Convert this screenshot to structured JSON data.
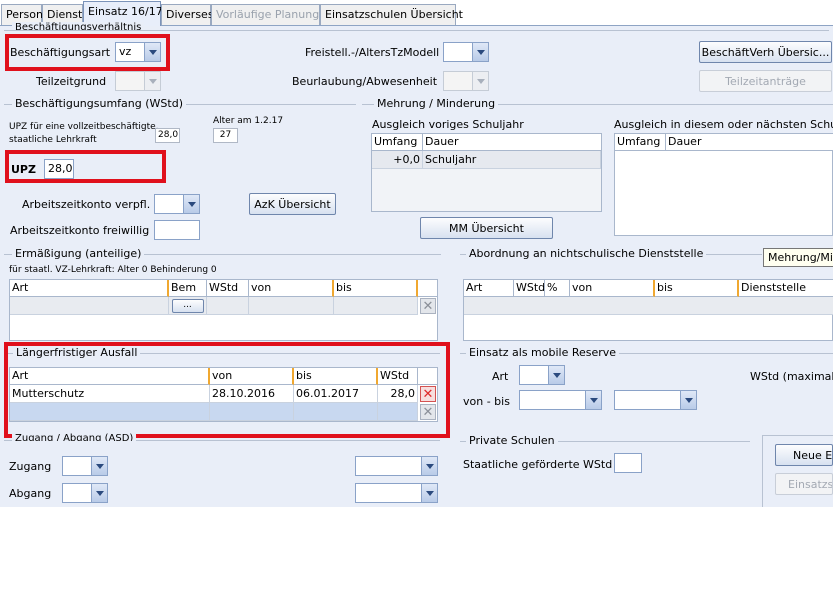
{
  "tabs": [
    {
      "label": "Person"
    },
    {
      "label": "Dienst"
    },
    {
      "label": "Einsatz 16/17"
    },
    {
      "label": "Diverses"
    },
    {
      "label": "Vorläufige Planung"
    },
    {
      "label": "Einsatzschulen Übersicht"
    }
  ],
  "beschaeftigungsverhaeltnis": {
    "title": "Beschäftigungsverhältnis",
    "art_label": "Beschäftigungsart",
    "art_value": "vz",
    "teilzeitgrund_label": "Teilzeitgrund",
    "freistell_label": "Freistell.-/AltersTzModell",
    "beurlaubung_label": "Beurlaubung/Abwesenheit",
    "btn_uebersicht": "BeschäftVerh Übersic...",
    "btn_teilzeit": "Teilzeitanträge"
  },
  "umfang": {
    "title": "Beschäftigungsumfang (WStd)",
    "upz_note_1": "UPZ für eine vollzeitbeschäftigte,",
    "upz_note_2": "staatliche Lehrkraft",
    "upz_note_value": "28,0",
    "alter_label": "Alter am 1.2.17",
    "alter_value": "27",
    "upz_label": "UPZ",
    "upz_value": "28,0",
    "azk_verpfl_label": "Arbeitszeitkonto verpfl.",
    "azk_freiwillig_label": "Arbeitszeitkonto freiwillig",
    "btn_azk": "AzK Übersicht"
  },
  "mehrung": {
    "title": "Mehrung / Minderung",
    "left_title": "Ausgleich voriges Schuljahr",
    "right_title": "Ausgleich in diesem oder nächsten Schulja",
    "col_umfang": "Umfang",
    "col_dauer": "Dauer",
    "row_umfang": "+0,0",
    "row_dauer": "Schuljahr",
    "btn_mm": "MM Übersicht",
    "tooltip": "Mehrung/Mi"
  },
  "ermaessigung": {
    "title": "Ermäßigung (anteilige)",
    "note": "für staatl. VZ-Lehrkraft: Alter 0 Behinderung 0",
    "columns": [
      "Art",
      "Bem",
      "WStd",
      "von",
      "bis"
    ],
    "ellipsis": "..."
  },
  "abordnung": {
    "title": "Abordnung an nichtschulische Dienststelle",
    "columns": [
      "Art",
      "WStd",
      "%",
      "von",
      "bis",
      "Dienststelle"
    ]
  },
  "ausfall": {
    "title": "Längerfristiger Ausfall",
    "columns": [
      "Art",
      "von",
      "bis",
      "WStd"
    ],
    "rows": [
      {
        "art": "Mutterschutz",
        "von": "28.10.2016",
        "bis": "06.01.2017",
        "wstd": "28,0"
      }
    ]
  },
  "mobile_reserve": {
    "title": "Einsatz als mobile Reserve",
    "art_label": "Art",
    "vonbis_label": "von - bis",
    "wstd_label": "WStd (maximal)"
  },
  "zugang": {
    "title": "Zugang / Abgang (ASD)",
    "zugang_label": "Zugang",
    "abgang_label": "Abgang"
  },
  "private": {
    "title": "Private Schulen",
    "foerder_label": "Staatliche geförderte WStd",
    "btn_neu": "Neue Ei",
    "btn_einsatz": "Einsatzsc"
  },
  "icons": {
    "delete": "delete-row-icon",
    "dropdown": "chevron-down-icon"
  },
  "colors": {
    "highlight": "#e0101c",
    "panel": "#e9eef8",
    "selected_row": "#c8d8f0"
  }
}
